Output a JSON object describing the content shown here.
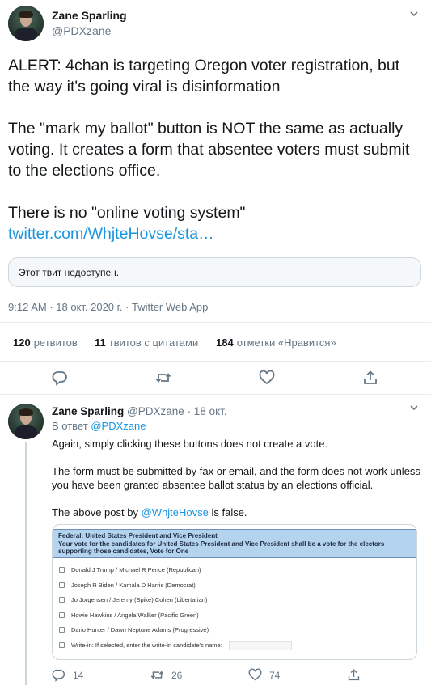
{
  "main_tweet": {
    "author_name": "Zane Sparling",
    "author_handle": "@PDXzane",
    "paragraphs": [
      "ALERT: 4chan is targeting Oregon voter registration, but the way it's going viral is disinformation",
      "The \"mark my ballot\" button is NOT the same as actually voting. It creates a form that absentee voters must submit to the elections office.",
      "There is no \"online voting system\""
    ],
    "link_text": "twitter.com/WhjteHovse/sta…",
    "quoted_unavailable": "Этот твит недоступен.",
    "meta": "9:12 AM · 18 окт. 2020 г. · Twitter Web App",
    "stats": {
      "retweets_count": "120",
      "retweets_label": "ретвитов",
      "quotes_count": "11",
      "quotes_label": "твитов с цитатами",
      "likes_count": "184",
      "likes_label": "отметки «Нравится»"
    },
    "actions": [
      "reply-icon",
      "retweet-icon",
      "like-icon",
      "share-icon"
    ]
  },
  "reply_tweet": {
    "author_name": "Zane Sparling",
    "author_handle": "@PDXzane",
    "date": "· 18 окт.",
    "reply_prefix": "В ответ",
    "reply_to": "@PDXzane",
    "p1": "Again, simply clicking these buttons does not create a vote.",
    "p2": "The form must be submitted by fax or email, and the form does not work unless you have been granted absentee ballot status by an elections official.",
    "p3_before": "The above post by ",
    "p3_link": "@WhjteHovse",
    "p3_after": " is false.",
    "ballot": {
      "line1": "Federal: United States President and Vice President",
      "line2": "Your vote for the candidates for United States President and Vice President shall be a vote for the electors",
      "line3": "supporting those candidates, Vote for One",
      "options": [
        "Donald J Trump / Michael R Pence (Republican)",
        "Joseph R Biden / Kamala D Harris (Democrat)",
        "Jo Jorgensen / Jeremy (Spike) Cohen (Libertarian)",
        "Howie Hawkins / Angela Walker (Pacific Green)",
        "Dario Hunter / Dawn Neptune Adams (Progressive)",
        "Write-in: If selected, enter the write-in candidate's name:"
      ]
    },
    "counts": {
      "replies": "14",
      "retweets": "26",
      "likes": "74"
    }
  },
  "colors": {
    "accent": "#1b95e0",
    "secondary_text": "#657786",
    "border": "#e6ecf0",
    "ballot_header": "#b4d3ef"
  }
}
